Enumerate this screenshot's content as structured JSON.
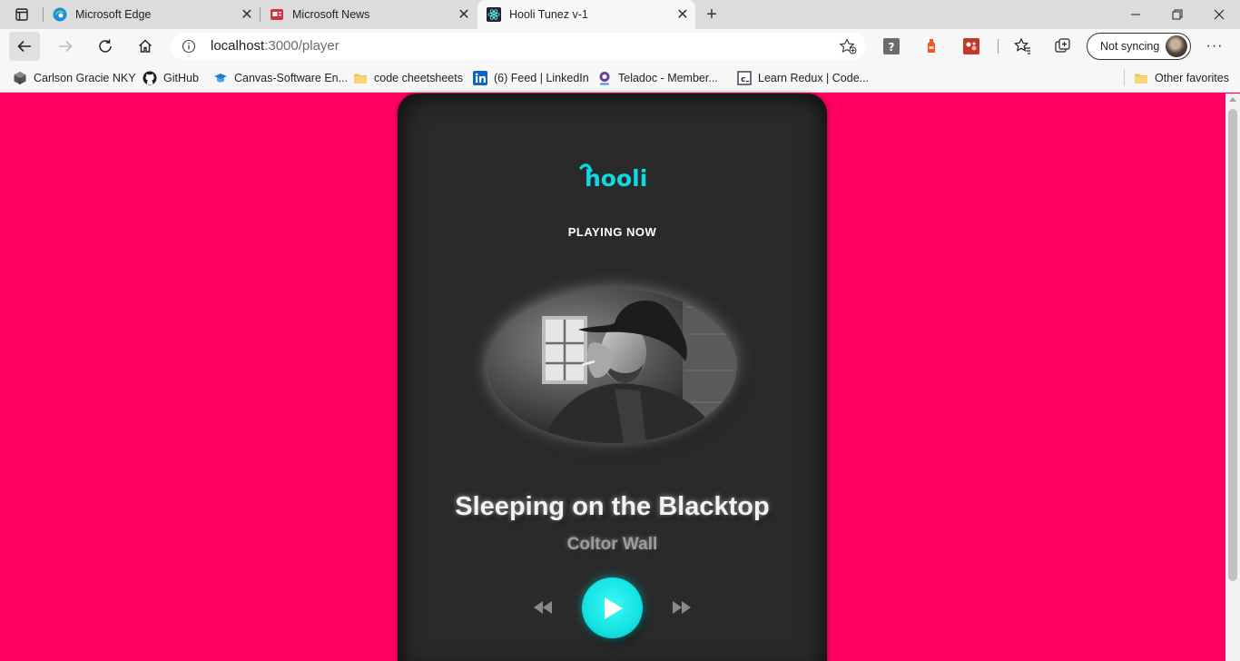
{
  "browser": {
    "tabs": [
      {
        "title": "Microsoft Edge",
        "icon": "edge-logo-icon",
        "active": false
      },
      {
        "title": "Microsoft News",
        "icon": "news-icon",
        "active": false
      },
      {
        "title": "Hooli Tunez v-1",
        "icon": "react-logo-icon",
        "active": true
      }
    ],
    "address": {
      "host": "localhost",
      "path": ":3000/player"
    },
    "sync_label": "Not syncing",
    "favorites": [
      {
        "label": "Carlson Gracie NKY",
        "icon": "cube-icon"
      },
      {
        "label": "GitHub",
        "icon": "github-icon"
      },
      {
        "label": "Canvas-Software En...",
        "icon": "canvas-icon"
      },
      {
        "label": "code cheetsheets",
        "icon": "folder-icon"
      },
      {
        "label": "(6) Feed | LinkedIn",
        "icon": "linkedin-icon"
      },
      {
        "label": "Teladoc - Member...",
        "icon": "teladoc-icon"
      },
      {
        "label": "Learn Redux | Code...",
        "icon": "codecademy-icon"
      }
    ],
    "other_favorites": "Other favorites"
  },
  "player": {
    "logo": "hooli",
    "status": "PLAYING NOW",
    "song_title": "Sleeping on the Blacktop",
    "artist": "Coltor Wall",
    "colors": {
      "page_bg": "#ff0062",
      "card_bg": "#2a2a2a",
      "accent": "#14e3e3",
      "logo": "#10d8e6"
    }
  }
}
